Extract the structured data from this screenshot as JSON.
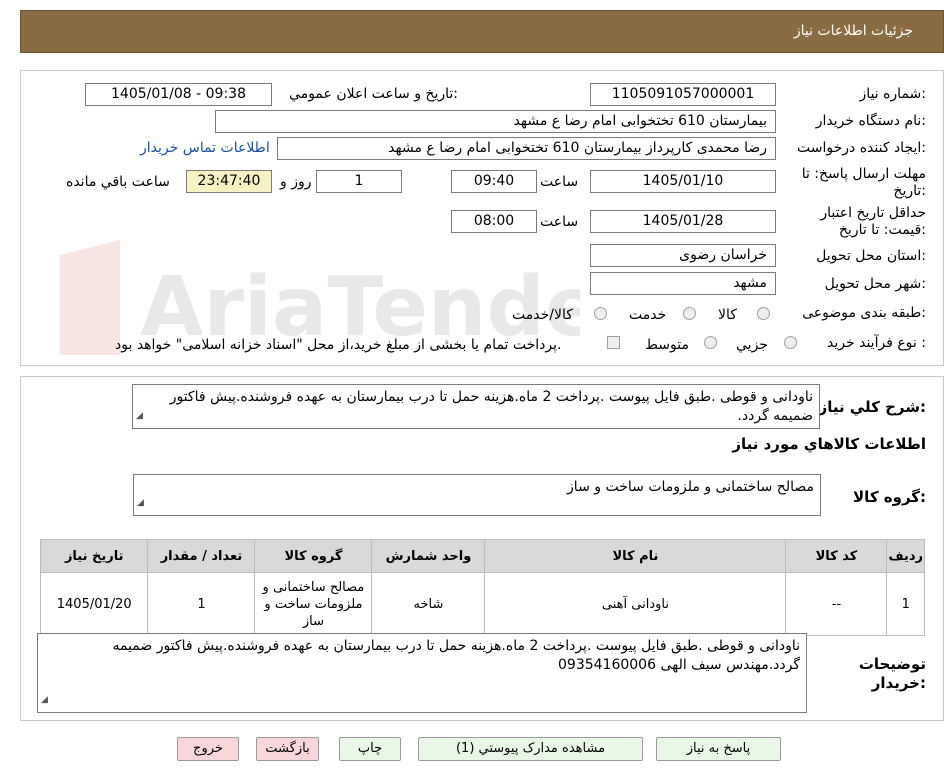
{
  "header": {
    "title": "جزئیات اطلاعات نیاز"
  },
  "fields": {
    "need_number_label": "شماره نیاز:",
    "need_number": "1105091057000001",
    "announce_label": "تاریخ و ساعت اعلان عمومي:",
    "announce_value": "1405/01/08 - 09:38",
    "buyer_org_label": "نام دستگاه خریدار:",
    "buyer_org": "بیمارستان 610 تختخوابی امام رضا ع  مشهد",
    "creator_label": "ایجاد کننده درخواست:",
    "creator": "رضا محمدی کارپرداز بیمارستان 610 تختخوابی امام رضا ع  مشهد",
    "contact_link": "اطلاعات تماس خریدار",
    "deadline_label": "مهلت ارسال پاسخ: تا تاریخ:",
    "deadline_date": "1405/01/10",
    "time_label": "ساعت",
    "deadline_time": "09:40",
    "days_value": "1",
    "days_label": "روز و",
    "remaining_value": "23:47:40",
    "remaining_label": "ساعت باقي مانده",
    "validity_label": "حداقل تاریخ اعتبار قیمت: تا تاریخ:",
    "validity_date": "1405/01/28",
    "validity_time": "08:00",
    "province_label": "استان محل تحویل:",
    "province": "خراسان رضوی",
    "city_label": "شهر محل تحویل:",
    "city": "مشهد",
    "category_label": "طبقه بندی موضوعی:",
    "category_options": [
      "کالا",
      "خدمت",
      "کالا/خدمت"
    ],
    "process_label": "نوع فرآیند خرید :",
    "process_options": [
      "جزيي",
      "متوسط"
    ],
    "payment_note": "پرداخت تمام یا بخشی از مبلغ خرید،از محل \"اسناد خزانه اسلامی\" خواهد بود."
  },
  "description": {
    "label": "شرح کلي نياز:",
    "text": "ناودانی و قوطی .طبق فایل پیوست .پرداخت 2 ماه.هزینه حمل تا درب بیمارستان به عهده فروشنده.پیش فاکتور ضمیمه گردد."
  },
  "goods": {
    "section_title": "اطلاعات کالاهاي مورد نياز",
    "group_label": "گروه کالا:",
    "group_value": "مصالح ساختمانی و ملزومات ساخت و ساز",
    "columns": [
      "رديف",
      "کد کالا",
      "نام کالا",
      "واحد شمارش",
      "گروه کالا",
      "تعداد / مقدار",
      "تاريخ نياز"
    ],
    "rows": [
      [
        "1",
        "--",
        "ناودانی آهنی",
        "شاخه",
        "مصالح ساختمانی و ملزومات ساخت و ساز",
        "1",
        "1405/01/20"
      ]
    ]
  },
  "buyer_notes": {
    "label": "توضیحات خریدار:",
    "text": "ناودانی و قوطی .طبق فایل پیوست .پرداخت 2 ماه.هزینه حمل تا درب بیمارستان به عهده فروشنده.پیش فاکتور ضمیمه گردد.مهندس سیف الهی 09354160006"
  },
  "buttons": {
    "reply": "پاسخ به نیاز",
    "attachments": "مشاهده مدارک پیوستي (1)",
    "print": "چاپ",
    "back": "بازگشت",
    "exit": "خروج"
  },
  "watermark": {
    "text": "AriaTender.neT"
  },
  "colors": {
    "header_bg": "#8b6b43",
    "link": "#1a4fa8",
    "button_green": "#e9f7e6",
    "button_pink": "#f8d6da",
    "remaining_bg": "#f6f2c3"
  }
}
